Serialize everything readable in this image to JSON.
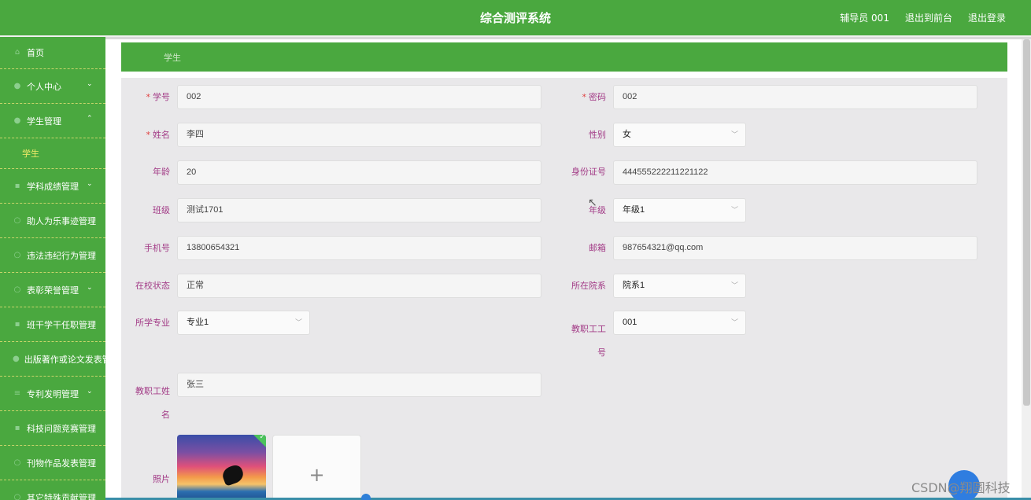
{
  "header": {
    "title": "综合测评系统",
    "user": "辅导员 001",
    "back_to_front": "退出到前台",
    "logout": "退出登录"
  },
  "sidebar": {
    "items": [
      {
        "label": "首页",
        "icon": "home-icon",
        "chevron": ""
      },
      {
        "label": "个人中心",
        "icon": "user-icon",
        "chevron": "⌄"
      },
      {
        "label": "学生管理",
        "icon": "student-icon",
        "chevron": "⌃"
      },
      {
        "label": "学生",
        "sub": true
      },
      {
        "label": "学科成绩管理",
        "icon": "book-icon",
        "chevron": "⌄"
      },
      {
        "label": "助人为乐事迹管理",
        "icon": "heart-icon",
        "chevron": ""
      },
      {
        "label": "违法违纪行为管理",
        "icon": "warning-icon",
        "chevron": ""
      },
      {
        "label": "表彰荣誉管理",
        "icon": "award-icon",
        "chevron": "⌄"
      },
      {
        "label": "班干学干任职管理",
        "icon": "badge-icon",
        "chevron": ""
      },
      {
        "label": "出版著作或论文发表管理",
        "icon": "document-icon",
        "chevron": ""
      },
      {
        "label": "专利发明管理",
        "icon": "list-icon",
        "chevron": "⌄"
      },
      {
        "label": "科技问题竞赛管理",
        "icon": "trophy-icon",
        "chevron": ""
      },
      {
        "label": "刊物作品发表管理",
        "icon": "magazine-icon",
        "chevron": ""
      },
      {
        "label": "其它特殊贡献管理",
        "icon": "star-icon",
        "chevron": ""
      }
    ]
  },
  "breadcrumb": "学生",
  "form": {
    "student_no": {
      "label": "学号",
      "value": "002"
    },
    "password": {
      "label": "密码",
      "value": "002"
    },
    "name": {
      "label": "姓名",
      "value": "李四"
    },
    "gender": {
      "label": "性别",
      "value": "女"
    },
    "age": {
      "label": "年龄",
      "value": "20"
    },
    "id_card": {
      "label": "身份证号",
      "value": "444555222211221122"
    },
    "class": {
      "label": "班级",
      "value": "测试1701"
    },
    "grade": {
      "label": "年级",
      "value": "年级1"
    },
    "phone": {
      "label": "手机号",
      "value": "13800654321"
    },
    "email": {
      "label": "邮箱",
      "value": "987654321@qq.com"
    },
    "school_status": {
      "label": "在校状态",
      "value": "正常"
    },
    "department": {
      "label": "所在院系",
      "value": "院系1"
    },
    "major": {
      "label": "所学专业",
      "value": "专业1"
    },
    "staff_no": {
      "label_line1": "教职工工",
      "label_line2": "号",
      "value": "001"
    },
    "staff_name": {
      "label_line1": "教职工姓",
      "label_line2": "名",
      "value": "张三"
    },
    "photo": {
      "label": "照片"
    }
  },
  "required_mark": "*",
  "watermark": "CSDN@翔圆科技"
}
